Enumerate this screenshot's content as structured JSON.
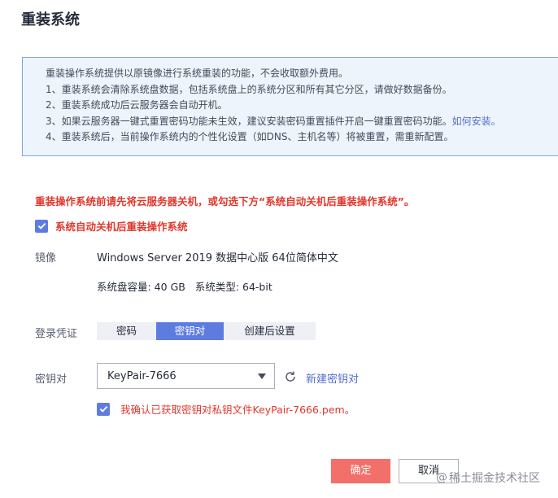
{
  "dialog": {
    "title": "重装系统"
  },
  "notice": {
    "lines": [
      "重装操作系统提供以原镜像进行系统重装的功能，不会收取额外费用。",
      "1、重装系统会清除系统盘数据，包括系统盘上的系统分区和所有其它分区，请做好数据备份。",
      "2、重装系统成功后云服务器会自动开机。",
      "3、如果云服务器一键式重置密码功能未生效，建议安装密码重置插件开启一键重置密码功能。",
      "4、重装系统后，当前操作系统内的个性化设置（如DNS、主机名等）将被重置，需重新配置。"
    ],
    "link": "如何安装。"
  },
  "warning": "重装操作系统前请先将云服务器关机，或勾选下方“系统自动关机后重装操作系统”。",
  "auto_shutdown": {
    "checked": true,
    "label": "系统自动关机后重装操作系统"
  },
  "image": {
    "label": "镜像",
    "name": "Windows Server 2019 数据中心版 64位简体中文",
    "disk": "系统盘容量: 40 GB",
    "system_type": "系统类型: 64-bit"
  },
  "login": {
    "label": "登录凭证",
    "tabs": [
      "密码",
      "密钥对",
      "创建后设置"
    ],
    "active_tab": "密钥对"
  },
  "keypair": {
    "label": "密钥对",
    "selected": "KeyPair-7666",
    "new_link": "新建密钥对",
    "confirm_checked": true,
    "confirm_label": "我确认已获取密钥对私钥文件KeyPair-7666.pem。"
  },
  "buttons": {
    "ok": "确定",
    "cancel": "取消"
  },
  "watermark": {
    "at": "@",
    "text": "稀土掘金技术社区"
  },
  "colors": {
    "accent": "#5e7ce0",
    "danger": "#e0382d",
    "primary_button": "#f36f6a",
    "link": "#526ecc",
    "notice_bg": "#edf4fc",
    "notice_border": "#7aa7df"
  }
}
